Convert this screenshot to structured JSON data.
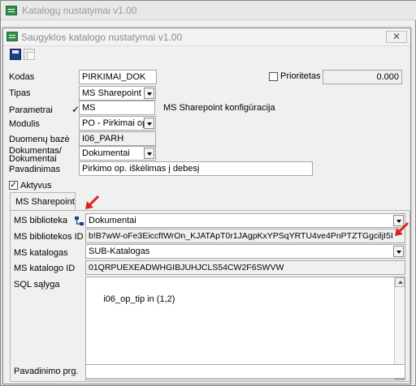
{
  "outer_window": {
    "title": "Katalogų nustatymai v1.00"
  },
  "dialog": {
    "title": "Saugyklos katalogo nustatymai v1.00",
    "close_label": "✕"
  },
  "icons": {
    "app": "app-icon",
    "save": "floppy-disk-icon",
    "copy": "copy-icon",
    "link": "hierarchy-link-icon",
    "annotation": "red-arrow-icon"
  },
  "colors": {
    "annotation_arrow": "#e02020",
    "app_icon": "#2f8f4a"
  },
  "form": {
    "kodas": {
      "label": "Kodas",
      "value": "PIRKIMAI_DOK"
    },
    "prioritetas": {
      "label": "Prioritetas",
      "checked": false,
      "value": "0.000"
    },
    "tipas": {
      "label": "Tipas",
      "value": "MS Sharepoint"
    },
    "parametrai": {
      "label": "Parametrai",
      "check_mark": "✓",
      "value": "MS",
      "description": "MS Sharepoint konfigūracija"
    },
    "modulis": {
      "label": "Modulis",
      "value": "PO - Pirkimai ope"
    },
    "duomenu_baze": {
      "label": "Duomenų bazė",
      "value": "I06_PARH"
    },
    "dokumentas": {
      "label_line1": "Dokumentas/",
      "label_line2": "Dokumentai",
      "value": "Dokumentai"
    },
    "pavadinimas": {
      "label": "Pavadinimas",
      "value": "Pirkimo op. iškėlimas į debesį"
    },
    "aktyvus": {
      "label": "Aktyvus",
      "checked": true,
      "mark": "✓"
    }
  },
  "tabs": [
    {
      "label": "MS Sharepoint",
      "active": true
    }
  ],
  "sharepoint": {
    "biblioteka": {
      "label": "MS biblioteka",
      "value": "Dokumentai"
    },
    "bibliotekos_id": {
      "label": "MS bibliotekos ID",
      "value": "b!B7wW-oFe3EiccftWrOn_KJATApT0r1JAgpKxYPSqYRTU4ve4PnPTZTGgciljI5I"
    },
    "katalogas": {
      "label": "MS katalogas",
      "value": "SUB-Katalogas"
    },
    "katalogo_id": {
      "label": "MS katalogo ID",
      "value": "01QRPUEXEADWHGIBJUHJCLS54CW2F6SWVW"
    },
    "sql": {
      "label": "SQL sąlyga",
      "value": "i06_op_tip in (1,2)"
    },
    "pavadinimo_prg": {
      "label": "Pavadinimo prg.",
      "value": ""
    }
  }
}
